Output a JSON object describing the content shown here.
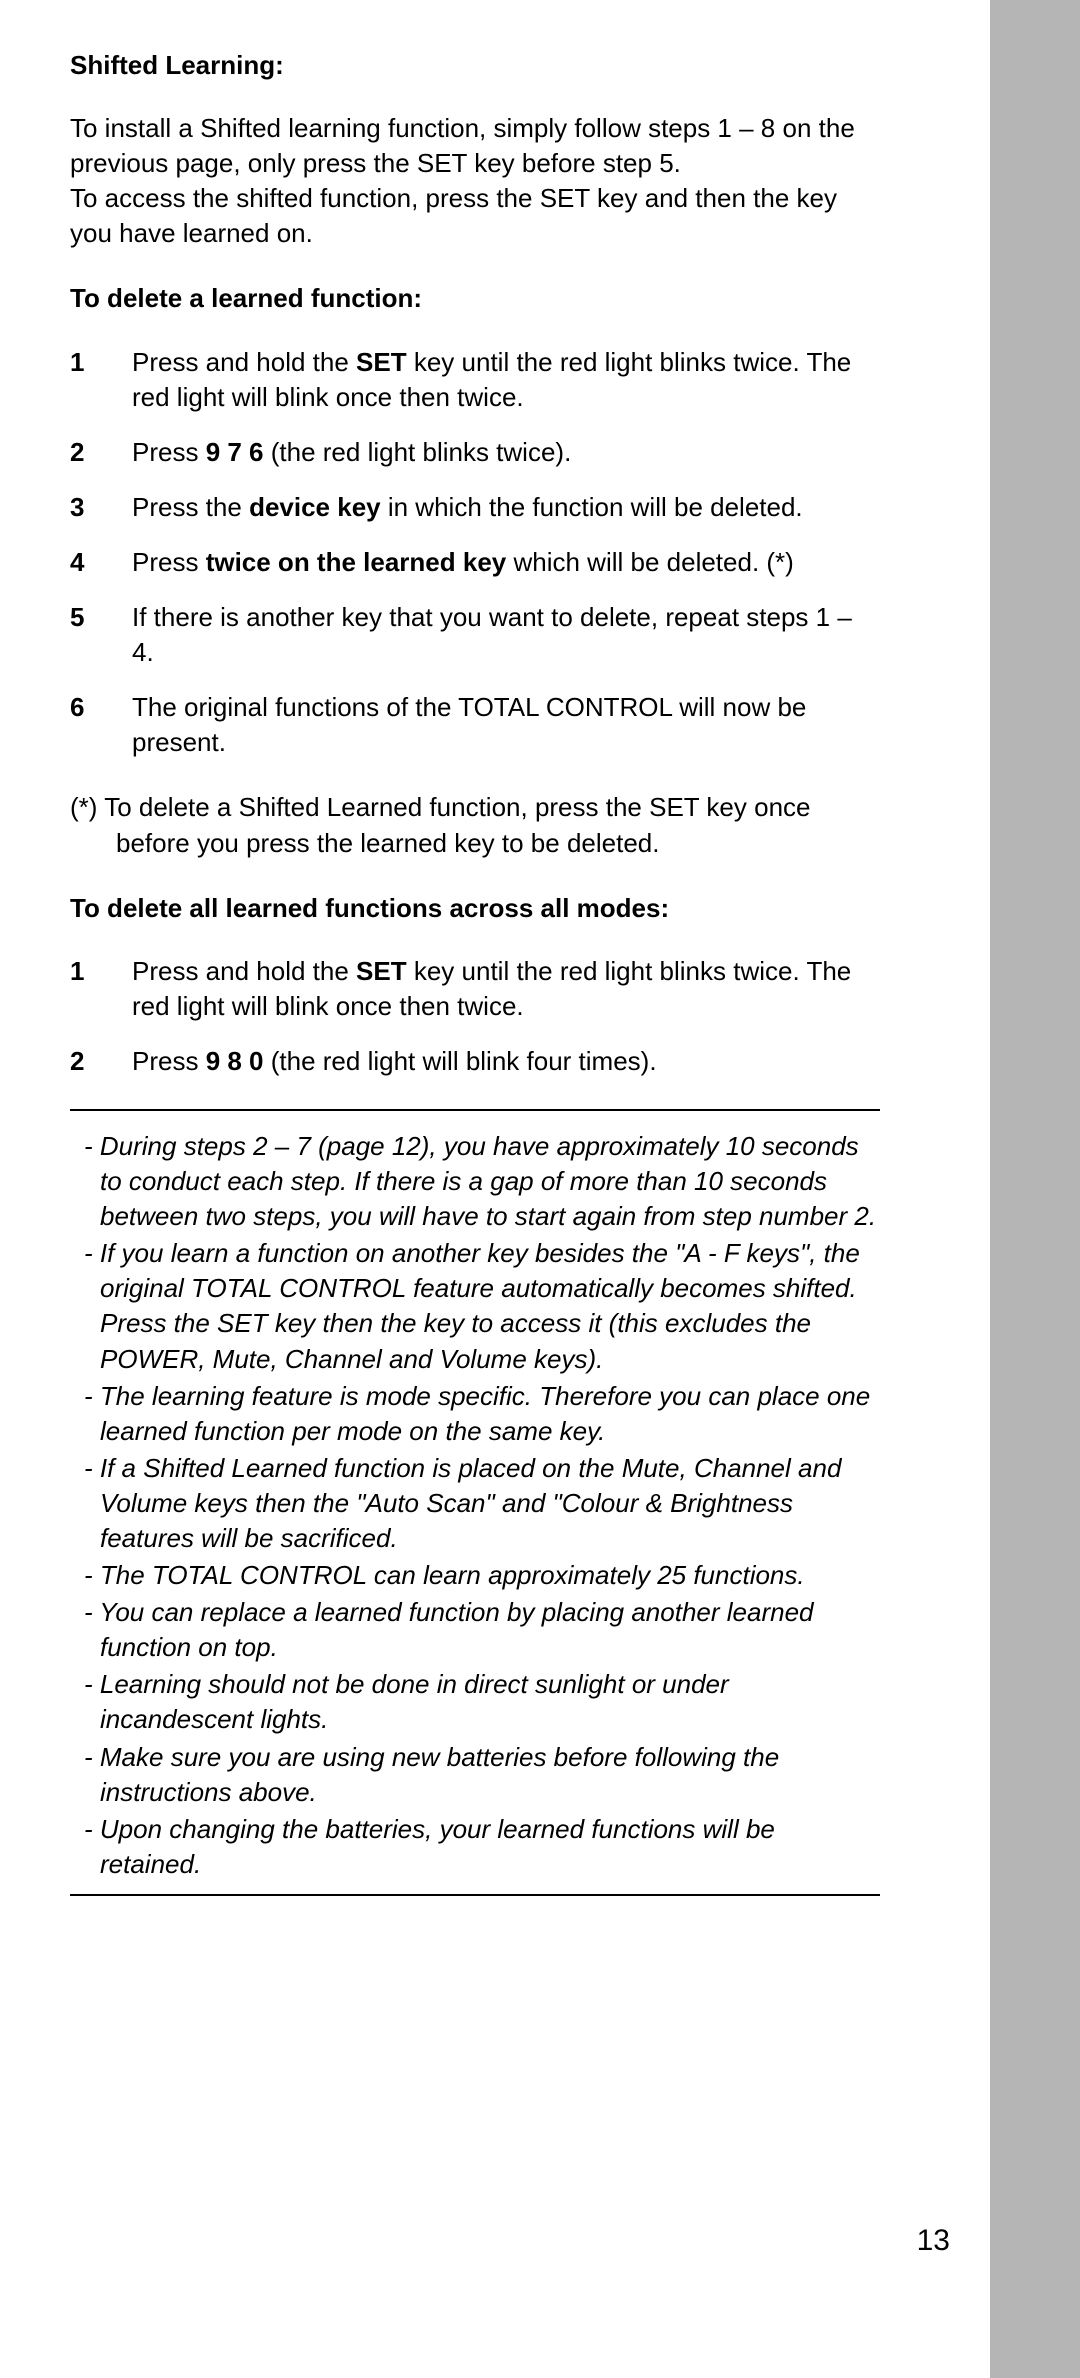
{
  "section1": {
    "title": "Shifted Learning:",
    "p1": "To install a Shifted learning function, simply follow steps 1 – 8 on the previous page, only press the SET key before step 5.",
    "p2": "To access the shifted function, press the SET key and then the key you have learned on."
  },
  "section2": {
    "title": "To delete a learned function:",
    "steps": [
      {
        "n": "1",
        "pre": "Press and hold the ",
        "b": "SET",
        "post": " key until the red light blinks twice. The red light will blink once then twice."
      },
      {
        "n": "2",
        "pre": "Press ",
        "b": "9 7 6",
        "post": " (the red light blinks twice)."
      },
      {
        "n": "3",
        "pre": "Press the ",
        "b": "device key",
        "post": " in which the function will be deleted."
      },
      {
        "n": "4",
        "pre": "Press ",
        "b": "twice on the learned key",
        "post": " which will be deleted. (*)"
      },
      {
        "n": "5",
        "pre": "If there is another key that you want to delete, repeat steps 1 – 4.",
        "b": "",
        "post": ""
      },
      {
        "n": "6",
        "pre": "The original functions of the TOTAL CONTROL will now be present.",
        "b": "",
        "post": ""
      }
    ],
    "footnote": "(*) To delete a Shifted Learned function, press the SET key once before you press the learned key to be deleted."
  },
  "section3": {
    "title": "To delete all learned functions across all modes:",
    "steps": [
      {
        "n": "1",
        "pre": "Press and hold the ",
        "b": "SET",
        "post": " key until the red light blinks twice. The red light will blink once then twice."
      },
      {
        "n": "2",
        "pre": "Press ",
        "b": "9 8 0",
        "post": " (the red light will blink four times)."
      }
    ]
  },
  "notes": [
    "During steps 2 – 7 (page 12), you have approximately 10 seconds to conduct each step. If there is a gap of more than 10 seconds between two steps, you will have to start again from step number 2.",
    "If you learn a function on another key besides the \"A - F keys\", the original TOTAL CONTROL feature automatically becomes shifted. Press the SET key then the key to access it (this excludes the POWER, Mute, Channel and Volume keys).",
    "The learning feature is mode specific. Therefore you can place one learned function per mode on the same key.",
    "If a Shifted Learned function is placed on the Mute, Channel and Volume keys then the \"Auto Scan\" and \"Colour & Brightness features will be sacrificed.",
    "The TOTAL CONTROL can learn approximately 25 functions.",
    "You can replace a learned function by placing another learned function on top.",
    "Learning should not be done in direct sunlight or under incandescent lights.",
    "Make sure you are using new batteries before following the instructions above.",
    "Upon changing the batteries, your learned functions will be retained."
  ],
  "pageNumber": "13"
}
